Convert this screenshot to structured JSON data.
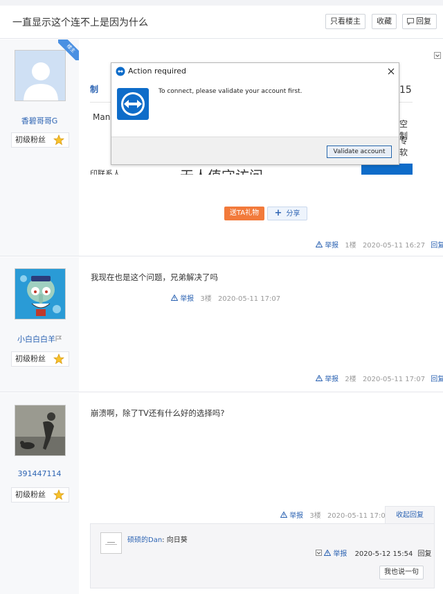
{
  "thread": {
    "title": "一直显示这个连不上是因为什么",
    "buttons": {
      "only_op": "只看楼主",
      "favorite": "收藏",
      "reply": "回复"
    }
  },
  "posts": [
    {
      "username": "香碧哥哥G",
      "fan_level": "初级粉丝",
      "badge": "楼主",
      "tail": {
        "report": "举报",
        "floor": "1楼",
        "time": "2020-05-11 16:27",
        "reply": "回复"
      }
    },
    {
      "username": "小白白白羊",
      "fan_level": "初级粉丝",
      "content": "我现在也是这个问题，兄弟解决了吗",
      "inner_tail": {
        "report": "举报",
        "floor": "3楼",
        "time": "2020-05-11 17:07"
      },
      "tail": {
        "report": "举报",
        "floor": "2楼",
        "time": "2020-05-11 17:07",
        "reply": "回复"
      }
    },
    {
      "username": "391447114",
      "fan_level": "初级粉丝",
      "content": "崩溃啊，除了TV还有什么好的选择吗?",
      "tail": {
        "report": "举报",
        "floor": "3楼",
        "time": "2020-05-11 17:07",
        "collapse": "收起回复"
      }
    }
  ],
  "screenshot": {
    "behind_left": [
      "制",
      "Man",
      "印联系人"
    ],
    "behind_right": [
      "15",
      "空制",
      "专软"
    ],
    "behind_bottom": "无人值守访问",
    "dialog": {
      "title": "Action required",
      "message": "To connect, please validate your account first.",
      "button": "Validate account"
    }
  },
  "post_actions": {
    "gift": "送TA礼物",
    "share": "分享"
  },
  "sub_reply": {
    "author": "硕硕的Dan",
    "separator": ": ",
    "text": "向日葵",
    "report": "举报",
    "time": "2020-5-12 15:54",
    "reply": "回复",
    "say_button": "我也说一句"
  },
  "colors": {
    "link": "#2d64b3",
    "gift": "#f27a3b",
    "sidebar": "#f7f8fa",
    "teamviewer": "#0e6cc9"
  }
}
